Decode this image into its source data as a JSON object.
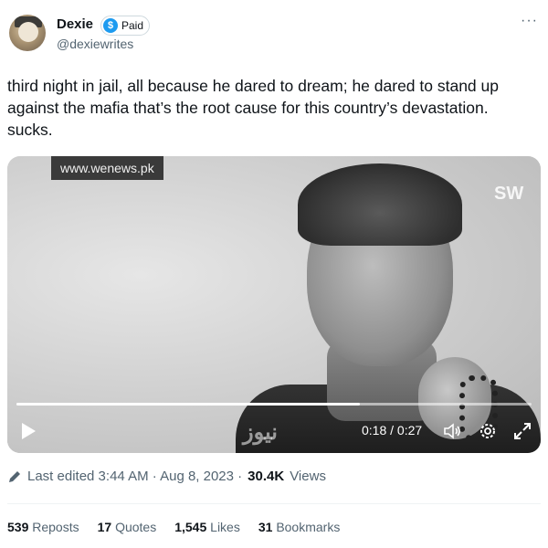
{
  "author": {
    "name": "Dexie",
    "badge_label": "Paid",
    "badge_icon": "$",
    "handle": "@dexiewrites"
  },
  "more_icon": "···",
  "tweet": {
    "text": "third night in jail, all because he dared to dream; he dared to stand up\nagainst the mafia that’s the root cause for this country’s devastation.\nsucks."
  },
  "video": {
    "watermark_url": "www.wenews.pk",
    "logo_mark": "SW",
    "urdu_logo": "نیوز",
    "time_display": "0:18 / 0:27",
    "progress_fraction": 0.667
  },
  "meta": {
    "edited_text": "Last edited 3:44 AM · Aug 8, 2023 ·",
    "views_count": "30.4K",
    "views_label": "Views"
  },
  "stats": {
    "reposts_count": "539",
    "reposts_label": "Reposts",
    "quotes_count": "17",
    "quotes_label": "Quotes",
    "likes_count": "1,545",
    "likes_label": "Likes",
    "bookmarks_count": "31",
    "bookmarks_label": "Bookmarks"
  },
  "colors": {
    "accent": "#1d9bf0",
    "text": "#0f1419",
    "muted": "#536471"
  }
}
